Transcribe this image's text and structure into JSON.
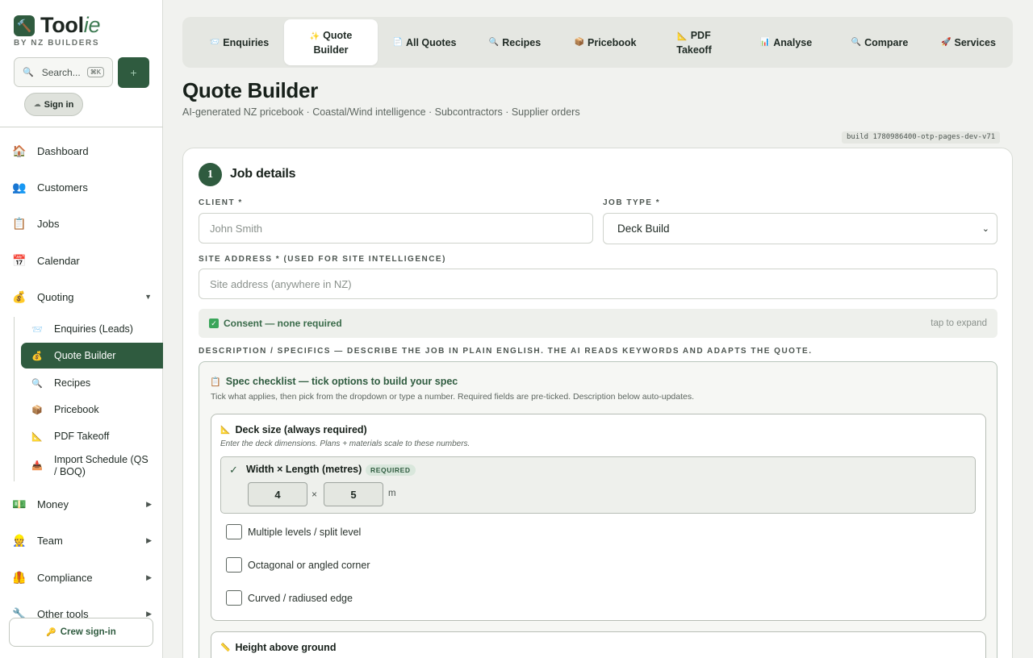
{
  "brand": {
    "name_main": "Tool",
    "name_italic": "ie",
    "subtitle": "BY NZ BUILDERS",
    "logo_icon": "hammer-icon",
    "logo_glyph": "🔨"
  },
  "search": {
    "placeholder": "Search...",
    "shortcut": "⌘K",
    "icon_glyph": "🔍"
  },
  "add_button": {
    "label": "+"
  },
  "sign_in": {
    "label": "Sign in",
    "icon_glyph": "☁"
  },
  "sidebar": {
    "items": [
      {
        "label": "Dashboard",
        "glyph": "🏠"
      },
      {
        "label": "Customers",
        "glyph": "👥"
      },
      {
        "label": "Jobs",
        "glyph": "📋"
      },
      {
        "label": "Calendar",
        "glyph": "📅"
      },
      {
        "label": "Quoting",
        "glyph": "💰",
        "caret": "▼"
      }
    ],
    "quoting_sub": [
      {
        "label": "Enquiries (Leads)",
        "glyph": "📨"
      },
      {
        "label": "Quote Builder",
        "glyph": "💰",
        "active": true
      },
      {
        "label": "Recipes",
        "glyph": "🔍"
      },
      {
        "label": "Pricebook",
        "glyph": "📦"
      },
      {
        "label": "PDF Takeoff",
        "glyph": "📐"
      },
      {
        "label_line1": "Import Schedule (QS",
        "label_line2": "/ BOQ)",
        "glyph": "📥"
      }
    ],
    "lower_items": [
      {
        "label": "Money",
        "glyph": "💵",
        "caret": "▶"
      },
      {
        "label": "Team",
        "glyph": "👷",
        "caret": "▶"
      },
      {
        "label": "Compliance",
        "glyph": "🦺",
        "caret": "▶"
      },
      {
        "label": "Other tools",
        "glyph": "🔧",
        "caret": "▶"
      }
    ],
    "crew_signin": {
      "label": "Crew sign-in",
      "glyph": "🔑"
    }
  },
  "tabs": [
    {
      "label": "Enquiries",
      "glyph": "📨"
    },
    {
      "label_line1": "Quote",
      "label_line2": "Builder",
      "glyph": "✨",
      "active": true
    },
    {
      "label": "All Quotes",
      "glyph": "📄"
    },
    {
      "label": "Recipes",
      "glyph": "🔍"
    },
    {
      "label": "Pricebook",
      "glyph": "📦"
    },
    {
      "label_line1": "PDF",
      "label_line2": "Takeoff",
      "glyph": "📐"
    },
    {
      "label": "Analyse",
      "glyph": "📊"
    },
    {
      "label": "Compare",
      "glyph": "🔍"
    },
    {
      "label": "Services",
      "glyph": "🚀"
    }
  ],
  "page": {
    "title": "Quote Builder",
    "subtitle": "AI-generated NZ pricebook · Coastal/Wind intelligence · Subcontractors · Supplier orders",
    "build": "build 1780986400-otp-pages-dev-v71"
  },
  "step1": {
    "number": "1",
    "title": "Job details",
    "client_label": "CLIENT *",
    "client_placeholder": "John Smith",
    "job_type_label": "JOB TYPE *",
    "job_type_value": "Deck Build",
    "site_label": "SITE ADDRESS * (USED FOR SITE INTELLIGENCE)",
    "site_placeholder": "Site address (anywhere in NZ)",
    "consent_text": "Consent — none required",
    "consent_glyph": "✓",
    "consent_expand": "tap to expand",
    "description_label": "DESCRIPTION / SPECIFICS — DESCRIBE THE JOB IN PLAIN ENGLISH. THE AI READS KEYWORDS AND ADAPTS THE QUOTE."
  },
  "spec": {
    "title": "Spec checklist — tick options to build your spec",
    "title_glyph": "📋",
    "help": "Tick what applies, then pick from the dropdown or type a number. Required fields are pre-ticked. Description below auto-updates.",
    "deck_size": {
      "title": "Deck size (always required)",
      "glyph": "📐",
      "help": "Enter the deck dimensions. Plans + materials scale to these numbers.",
      "row_label": "Width × Length (metres)",
      "check_glyph": "✓",
      "badge": "REQUIRED",
      "width": "4",
      "length": "5",
      "times": "×",
      "unit": "m"
    },
    "options": [
      {
        "label": "Multiple levels / split level",
        "checked": false
      },
      {
        "label": "Octagonal or angled corner",
        "checked": false
      },
      {
        "label": "Curved / radiused edge",
        "checked": false
      }
    ],
    "height": {
      "title": "Height above ground",
      "glyph": "📏"
    }
  }
}
